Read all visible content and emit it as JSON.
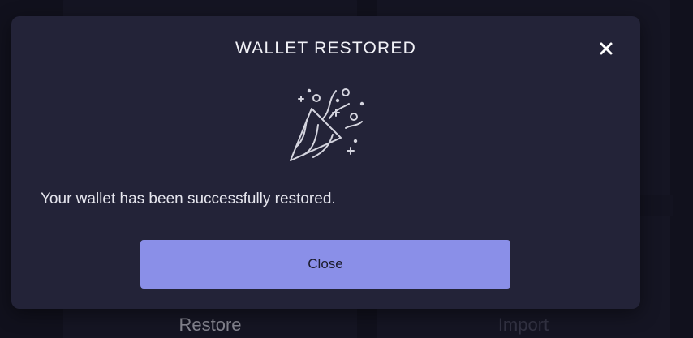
{
  "background": {
    "left_card_label": "Restore",
    "right_card_label": "Import"
  },
  "modal": {
    "title": "WALLET RESTORED",
    "close_icon": "close-icon",
    "illustration_icon": "party-popper-icon",
    "message": "Your wallet has been successfully restored.",
    "close_button_label": "Close"
  },
  "colors": {
    "page_background": "#161624",
    "modal_background": "#232338",
    "button_accent": "#8a8fe8",
    "text_primary": "#f2f2f7"
  }
}
